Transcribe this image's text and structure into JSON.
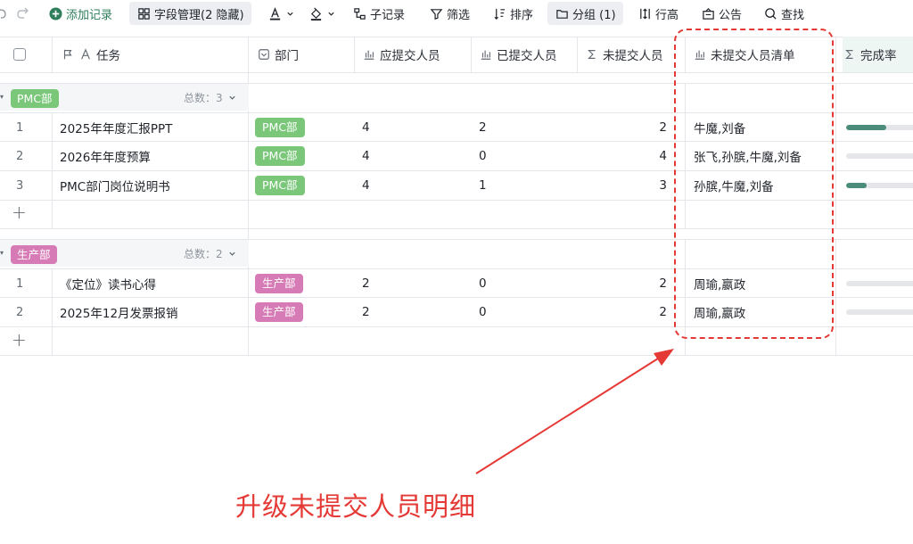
{
  "toolbar": {
    "items": [
      {
        "label": "添加记录",
        "icon": "plus-circle-icon"
      },
      {
        "label": "字段管理(2 隐藏)",
        "icon": "grid-icon"
      },
      {
        "label": "",
        "icon": "text-color-icon"
      },
      {
        "label": "",
        "icon": "fill-color-icon"
      },
      {
        "label": "子记录",
        "icon": "sub-record-icon"
      },
      {
        "label": "筛选",
        "icon": "filter-icon"
      },
      {
        "label": "排序",
        "icon": "sort-icon"
      },
      {
        "label": "分组 (1)",
        "icon": "folder-icon"
      },
      {
        "label": "行高",
        "icon": "row-height-icon"
      },
      {
        "label": "公告",
        "icon": "announcement-icon"
      },
      {
        "label": "查找",
        "icon": "search-icon"
      }
    ]
  },
  "columns": [
    {
      "label": "任务",
      "icon": "flag-text-icon"
    },
    {
      "label": "部门",
      "icon": "select-icon"
    },
    {
      "label": "应提交人员",
      "icon": "chart-icon"
    },
    {
      "label": "已提交人员",
      "icon": "chart-icon"
    },
    {
      "label": "未提交人员",
      "icon": "sigma-icon"
    },
    {
      "label": "未提交人员清单",
      "icon": "chart-icon"
    },
    {
      "label": "完成率",
      "icon": "sigma-icon"
    }
  ],
  "groups": [
    {
      "name": "PMC部",
      "count_label": "总数：3",
      "color": "#7ac77a",
      "rows": [
        {
          "index": "1",
          "task": "2025年年度汇报PPT",
          "dept": "PMC部",
          "required": "4",
          "submitted": "2",
          "unsubmitted": "2",
          "list": "牛魔,刘备",
          "rate": 0.5
        },
        {
          "index": "2",
          "task": "2026年年度预算",
          "dept": "PMC部",
          "required": "4",
          "submitted": "0",
          "unsubmitted": "4",
          "list": "张飞,孙膑,牛魔,刘备",
          "rate": 0
        },
        {
          "index": "3",
          "task": "PMC部门岗位说明书",
          "dept": "PMC部",
          "required": "4",
          "submitted": "1",
          "unsubmitted": "3",
          "list": "孙膑,牛魔,刘备",
          "rate": 0.25
        }
      ]
    },
    {
      "name": "生产部",
      "count_label": "总数：2",
      "color": "#d67bb5",
      "rows": [
        {
          "index": "1",
          "task": "《定位》读书心得",
          "dept": "生产部",
          "required": "2",
          "submitted": "0",
          "unsubmitted": "2",
          "list": "周瑜,嬴政",
          "rate": 0
        },
        {
          "index": "2",
          "task": "2025年12月发票报销",
          "dept": "生产部",
          "required": "2",
          "submitted": "0",
          "unsubmitted": "2",
          "list": "周瑜,嬴政",
          "rate": 0
        }
      ]
    }
  ],
  "add_row_symbol": "+",
  "annotation": "升级未提交人员明细",
  "colors": {
    "accent_red": "#e53935",
    "progress": "#4c8c7a"
  }
}
